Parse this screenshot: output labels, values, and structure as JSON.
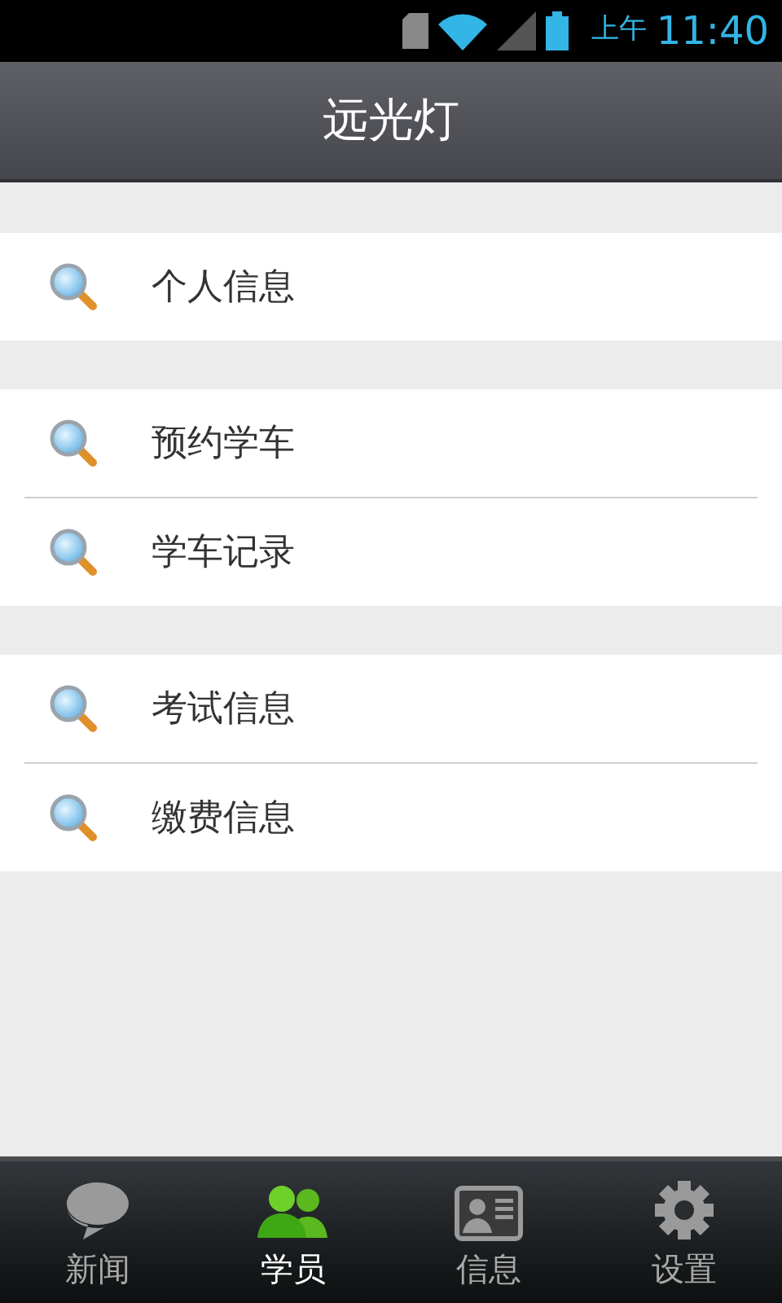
{
  "status_bar": {
    "period": "上午",
    "time": "11:40"
  },
  "header": {
    "title": "远光灯"
  },
  "groups": [
    {
      "items": [
        {
          "label": "个人信息"
        }
      ]
    },
    {
      "items": [
        {
          "label": "预约学车"
        },
        {
          "label": "学车记录"
        }
      ]
    },
    {
      "items": [
        {
          "label": "考试信息"
        },
        {
          "label": "缴费信息"
        }
      ]
    }
  ],
  "tabs": [
    {
      "kind": "chat",
      "label": "新闻",
      "selected": false
    },
    {
      "kind": "people",
      "label": "学员",
      "selected": true
    },
    {
      "kind": "card",
      "label": "信息",
      "selected": false
    },
    {
      "kind": "gear",
      "label": "设置",
      "selected": false
    }
  ]
}
